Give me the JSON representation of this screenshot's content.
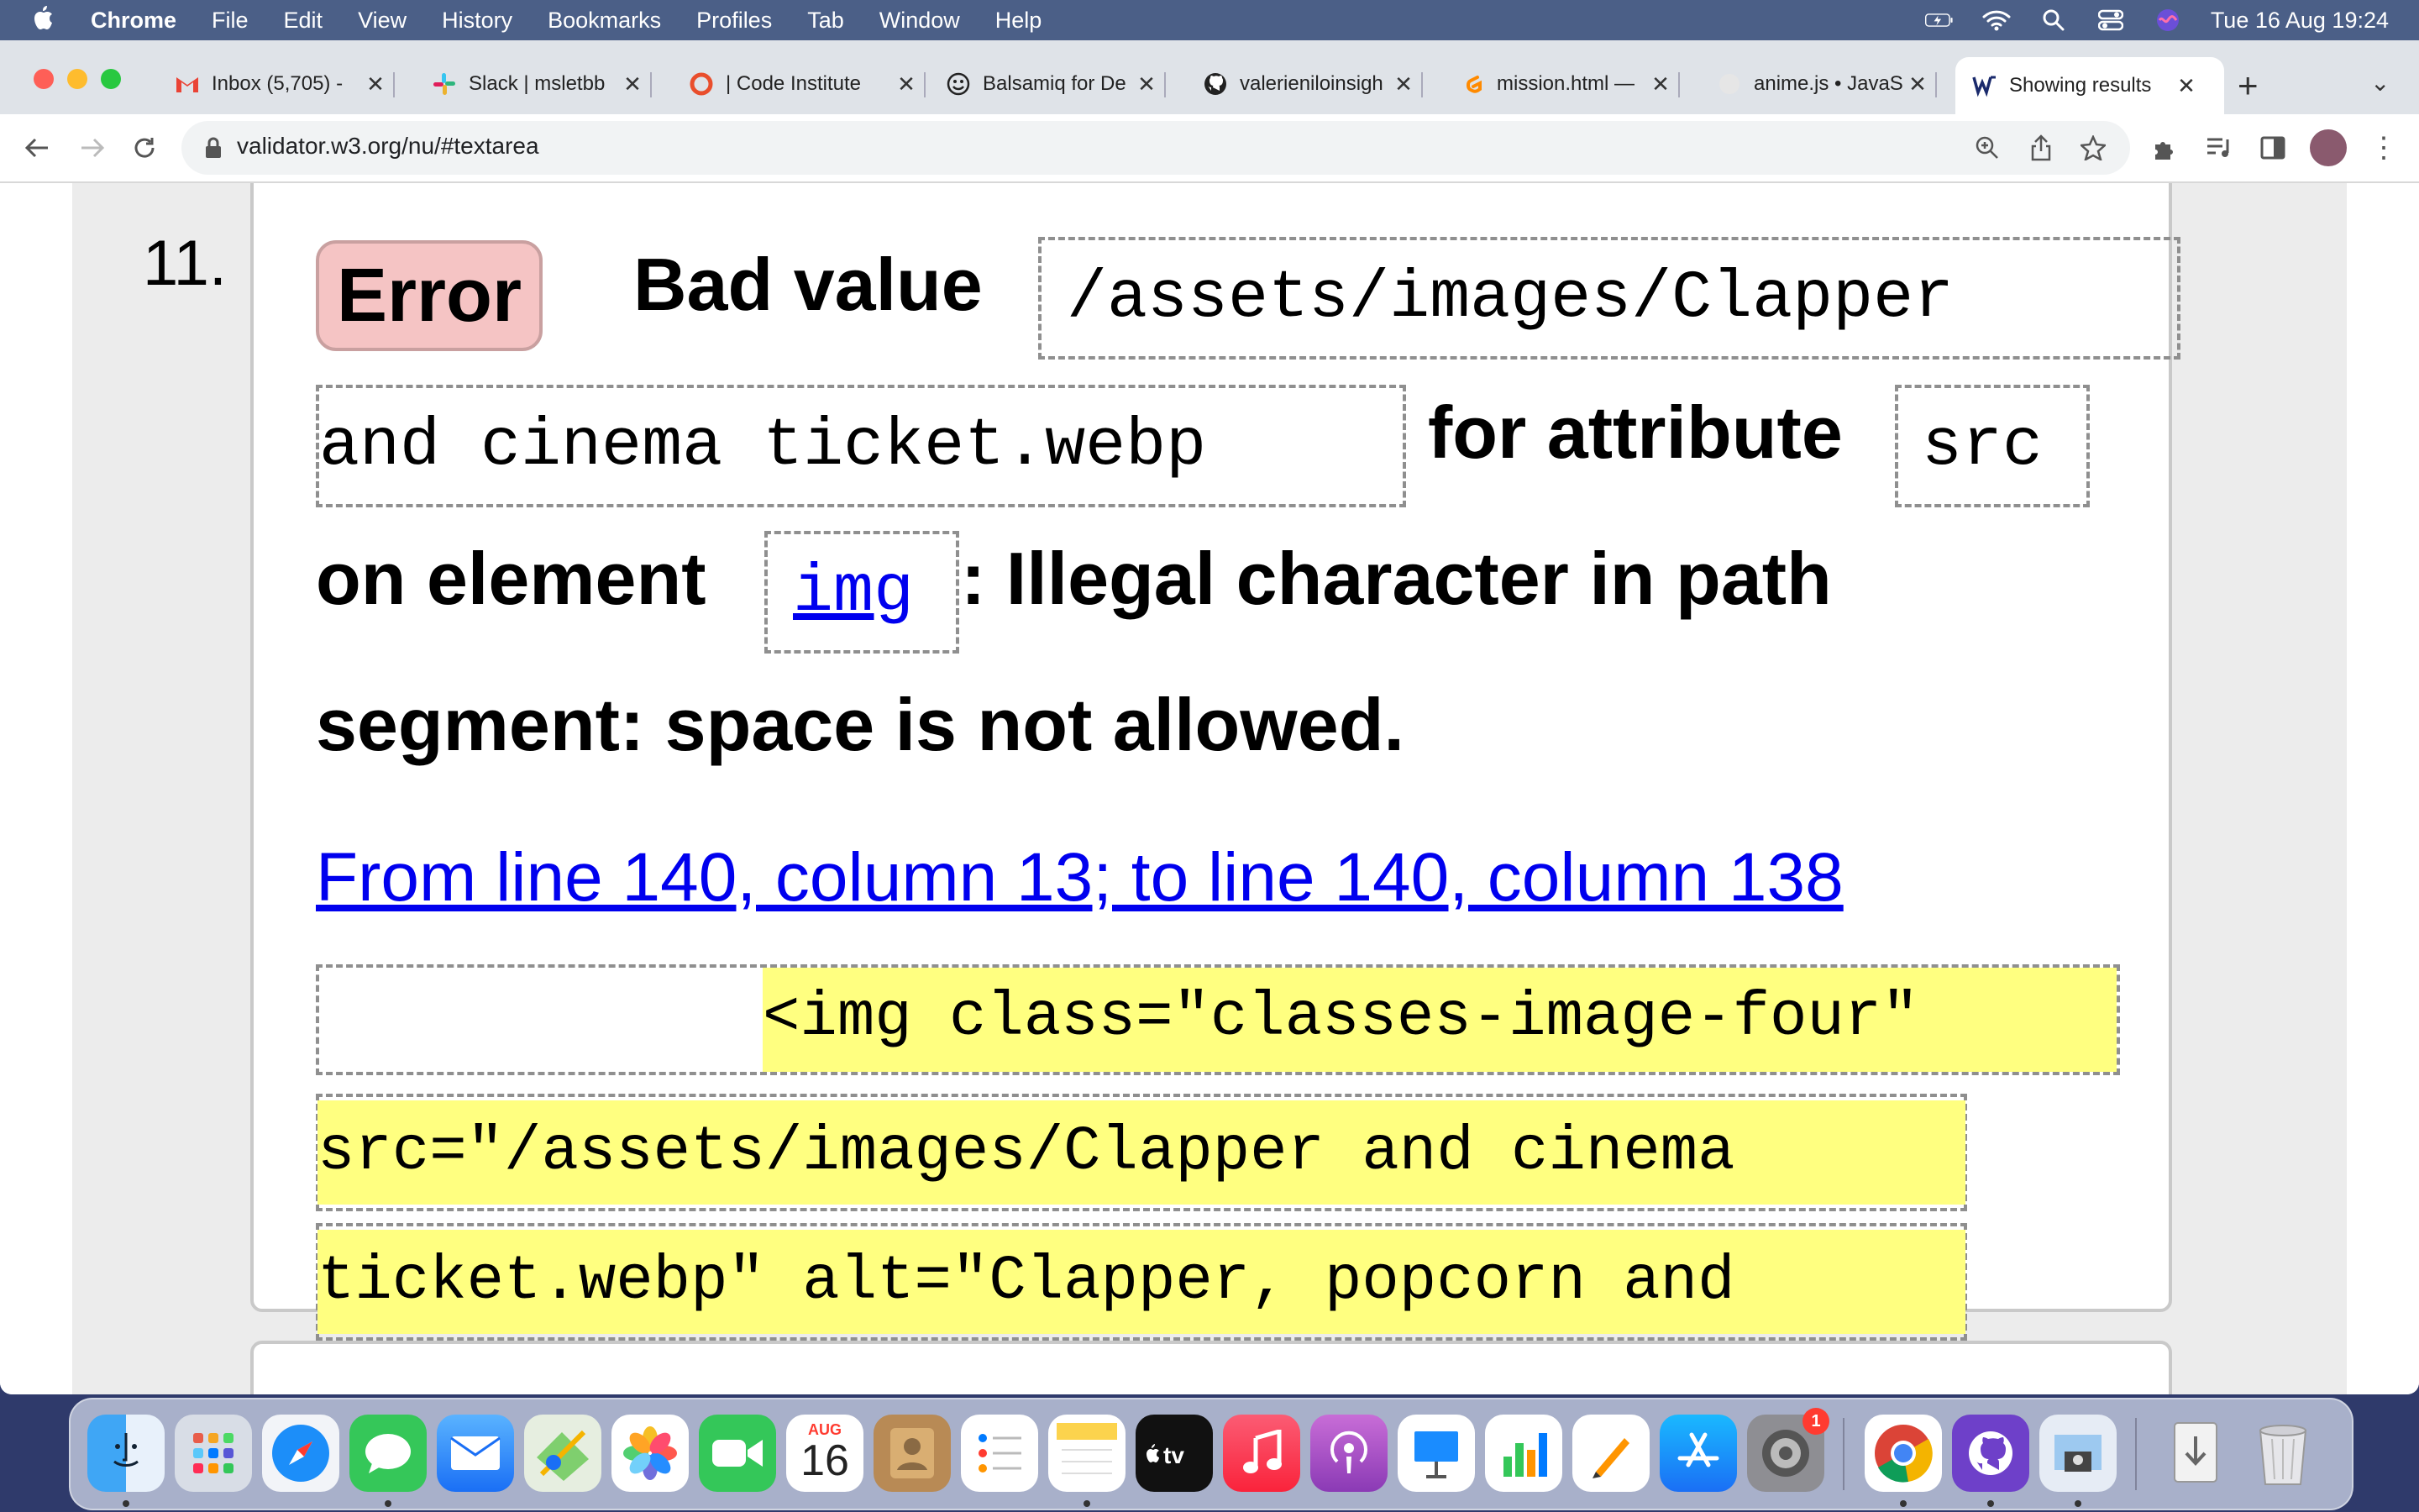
{
  "menubar": {
    "app": "Chrome",
    "items": [
      "File",
      "Edit",
      "View",
      "History",
      "Bookmarks",
      "Profiles",
      "Tab",
      "Window",
      "Help"
    ],
    "datetime": "Tue 16 Aug  19:24"
  },
  "tabs": [
    {
      "title": "Inbox (5,705) -",
      "icon": "gmail-icon"
    },
    {
      "title": "Slack | msletbb",
      "icon": "slack-icon"
    },
    {
      "title": "| Code Institute",
      "icon": "code-institute-icon"
    },
    {
      "title": "Balsamiq for De",
      "icon": "balsamiq-icon"
    },
    {
      "title": "valerieniloinsigh",
      "icon": "github-icon"
    },
    {
      "title": "mission.html —",
      "icon": "gitpod-icon"
    },
    {
      "title": "anime.js • JavaS",
      "icon": "anime-icon"
    },
    {
      "title": "Showing results",
      "icon": "w3c-validator-icon"
    }
  ],
  "toolbar": {
    "url": "validator.w3.org/nu/#textarea"
  },
  "message": {
    "number": "11.",
    "type_label": "Error",
    "text_bad_value": "Bad value",
    "value": "/assets/images/Clapper and cinema ticket.webp",
    "value_part1": "/assets/images/Clapper",
    "value_part2": "and cinema ticket.webp",
    "text_for_attribute": "for attribute",
    "attribute": "src",
    "text_on_element": "on element",
    "element": "img",
    "text_reason_1": ": Illegal character in path",
    "text_reason_2": "segment: space is not allowed.",
    "location": "From line 140, column 13; to line 140, column 138",
    "extract_lines": [
      "<img class=\"classes-image-four\"",
      "src=\"/assets/images/Clapper and cinema",
      "ticket.webp\" alt=\"Clapper, popcorn and"
    ]
  },
  "dock": {
    "calendar_month": "AUG",
    "calendar_day": "16",
    "settings_badge": "1",
    "apps": [
      "finder-icon",
      "launchpad-icon",
      "safari-icon",
      "messages-icon",
      "mail-icon",
      "maps-icon",
      "photos-icon",
      "facetime-icon",
      "calendar-icon",
      "contacts-icon",
      "reminders-icon",
      "notes-icon",
      "apple-tv-icon",
      "music-icon",
      "podcasts-icon",
      "keynote-icon",
      "numbers-icon",
      "pages-icon",
      "app-store-icon",
      "system-preferences-icon",
      "chrome-icon",
      "github-desktop-icon",
      "preview-icon",
      "downloads-icon",
      "trash-icon"
    ]
  }
}
